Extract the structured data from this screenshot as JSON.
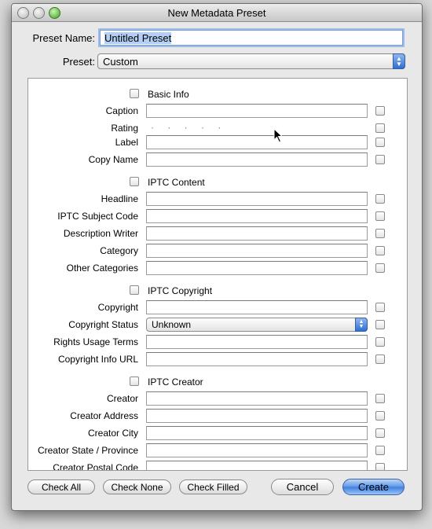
{
  "dialog": {
    "title": "New Metadata Preset"
  },
  "preset_name": {
    "label": "Preset Name:",
    "value": "Untitled Preset"
  },
  "preset": {
    "label": "Preset:",
    "value": "Custom"
  },
  "sections": [
    {
      "title": "Basic Info",
      "fields": [
        {
          "label": "Caption",
          "type": "text",
          "value": ""
        },
        {
          "label": "Rating",
          "type": "rating",
          "value": "· · · · ·"
        },
        {
          "label": "Label",
          "type": "text",
          "value": ""
        },
        {
          "label": "Copy Name",
          "type": "text",
          "value": ""
        }
      ]
    },
    {
      "title": "IPTC Content",
      "fields": [
        {
          "label": "Headline",
          "type": "text",
          "value": ""
        },
        {
          "label": "IPTC Subject Code",
          "type": "text",
          "value": ""
        },
        {
          "label": "Description Writer",
          "type": "text",
          "value": ""
        },
        {
          "label": "Category",
          "type": "text",
          "value": ""
        },
        {
          "label": "Other Categories",
          "type": "text",
          "value": ""
        }
      ]
    },
    {
      "title": "IPTC Copyright",
      "fields": [
        {
          "label": "Copyright",
          "type": "text",
          "value": ""
        },
        {
          "label": "Copyright Status",
          "type": "select",
          "value": "Unknown"
        },
        {
          "label": "Rights Usage Terms",
          "type": "text",
          "value": ""
        },
        {
          "label": "Copyright Info URL",
          "type": "text",
          "value": ""
        }
      ]
    },
    {
      "title": "IPTC Creator",
      "fields": [
        {
          "label": "Creator",
          "type": "text",
          "value": ""
        },
        {
          "label": "Creator Address",
          "type": "text",
          "value": ""
        },
        {
          "label": "Creator City",
          "type": "text",
          "value": ""
        },
        {
          "label": "Creator State / Province",
          "type": "text",
          "value": ""
        },
        {
          "label": "Creator Postal Code",
          "type": "text",
          "value": ""
        }
      ]
    }
  ],
  "buttons": {
    "check_all": "Check All",
    "check_none": "Check None",
    "check_filled": "Check Filled",
    "cancel": "Cancel",
    "create": "Create"
  },
  "colors": {
    "accent": "#3f7fe0",
    "selection": "#b4cff5"
  }
}
